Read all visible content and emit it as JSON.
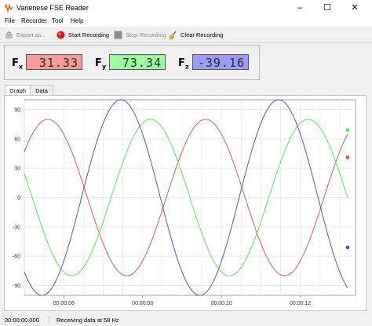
{
  "window": {
    "title": "Varienese FSE Reader",
    "minimize": "–",
    "maximize": "☐",
    "close": "✕"
  },
  "menu": [
    "File",
    "Recorder",
    "Tool",
    "Help"
  ],
  "toolbar": {
    "export": "Export as...",
    "start": "Start Recording",
    "stop": "Stop Recording",
    "clear": "Clear Recording"
  },
  "readouts": {
    "fx": {
      "name": "F",
      "sub": "x",
      "value": "31.33",
      "color": "#ff9a9a"
    },
    "fy": {
      "name": "F",
      "sub": "y",
      "value": "73.34",
      "color": "#9bff9b"
    },
    "fz": {
      "name": "F",
      "sub": "z",
      "value": "-39.16",
      "color": "#9a9aff"
    }
  },
  "tabs": {
    "graph": "Graph",
    "data": "Data"
  },
  "chart_data": {
    "type": "line",
    "ylim": [
      -100,
      100
    ],
    "yticks": [
      "90",
      "60",
      "30",
      "0",
      "-30",
      "-60",
      "-90"
    ],
    "ytick_values": [
      90,
      60,
      30,
      0,
      -30,
      -60,
      -90
    ],
    "xlim": [
      5.0,
      13.4
    ],
    "xticks": [
      "00:00:06",
      "00:00:08",
      "00:00:10",
      "00:00:12"
    ],
    "xtick_values": [
      6,
      8,
      10,
      12
    ],
    "grid": true,
    "series": [
      {
        "color": "#d0605c",
        "amp": 80,
        "period": 4.0,
        "phase_peak": 5.6,
        "end": [
          13.2,
          41
        ]
      },
      {
        "color": "#5fe05f",
        "amp": 80,
        "period": 4.0,
        "phase_peak": 8.2,
        "end": [
          13.2,
          69
        ]
      },
      {
        "color": "#5555bb",
        "amp": 100,
        "period": 4.0,
        "phase_peak": 7.45,
        "end": [
          13.2,
          -51
        ]
      }
    ]
  },
  "status": {
    "time": "00:00:00.000",
    "message": "Receiving data at 58 Hz"
  }
}
